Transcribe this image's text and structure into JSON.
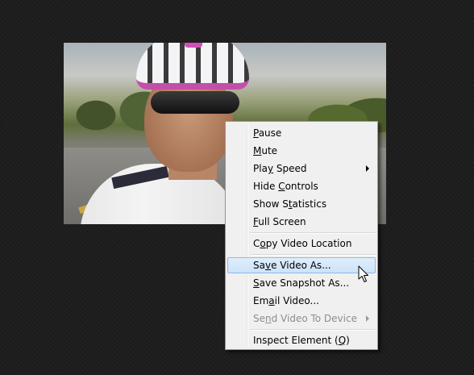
{
  "video": {
    "description_icon": "video-frame"
  },
  "context_menu": {
    "items": [
      {
        "label": "Pause",
        "access_key": "P",
        "enabled": true
      },
      {
        "label": "Mute",
        "access_key": "M",
        "enabled": true
      },
      {
        "label": "Play Speed",
        "access_key": "y",
        "enabled": true,
        "submenu": true
      },
      {
        "label": "Hide Controls",
        "access_key": "C",
        "enabled": true
      },
      {
        "label": "Show Statistics",
        "access_key": "t",
        "enabled": true
      },
      {
        "label": "Full Screen",
        "access_key": "F",
        "enabled": true
      },
      {
        "label": "Copy Video Location",
        "access_key": "o",
        "enabled": true
      },
      {
        "label": "Save Video As...",
        "access_key": "v",
        "enabled": true,
        "selected": true
      },
      {
        "label": "Save Snapshot As...",
        "access_key": "S",
        "enabled": true
      },
      {
        "label": "Email Video...",
        "access_key": "a",
        "enabled": true
      },
      {
        "label": "Send Video To Device",
        "access_key": "n",
        "enabled": false,
        "submenu": true
      },
      {
        "label": "Inspect Element (Q)",
        "access_key": "Q",
        "enabled": true
      }
    ]
  },
  "colors": {
    "background": "#1d1d1d",
    "menu_bg": "#f0f0f0",
    "highlight_bg": "#cde3f9",
    "highlight_border": "#8fb9e8",
    "disabled_text": "#8d8d8d"
  },
  "icons": {
    "submenu": "chevron-right-icon",
    "pointer": "mouse-cursor-icon"
  }
}
